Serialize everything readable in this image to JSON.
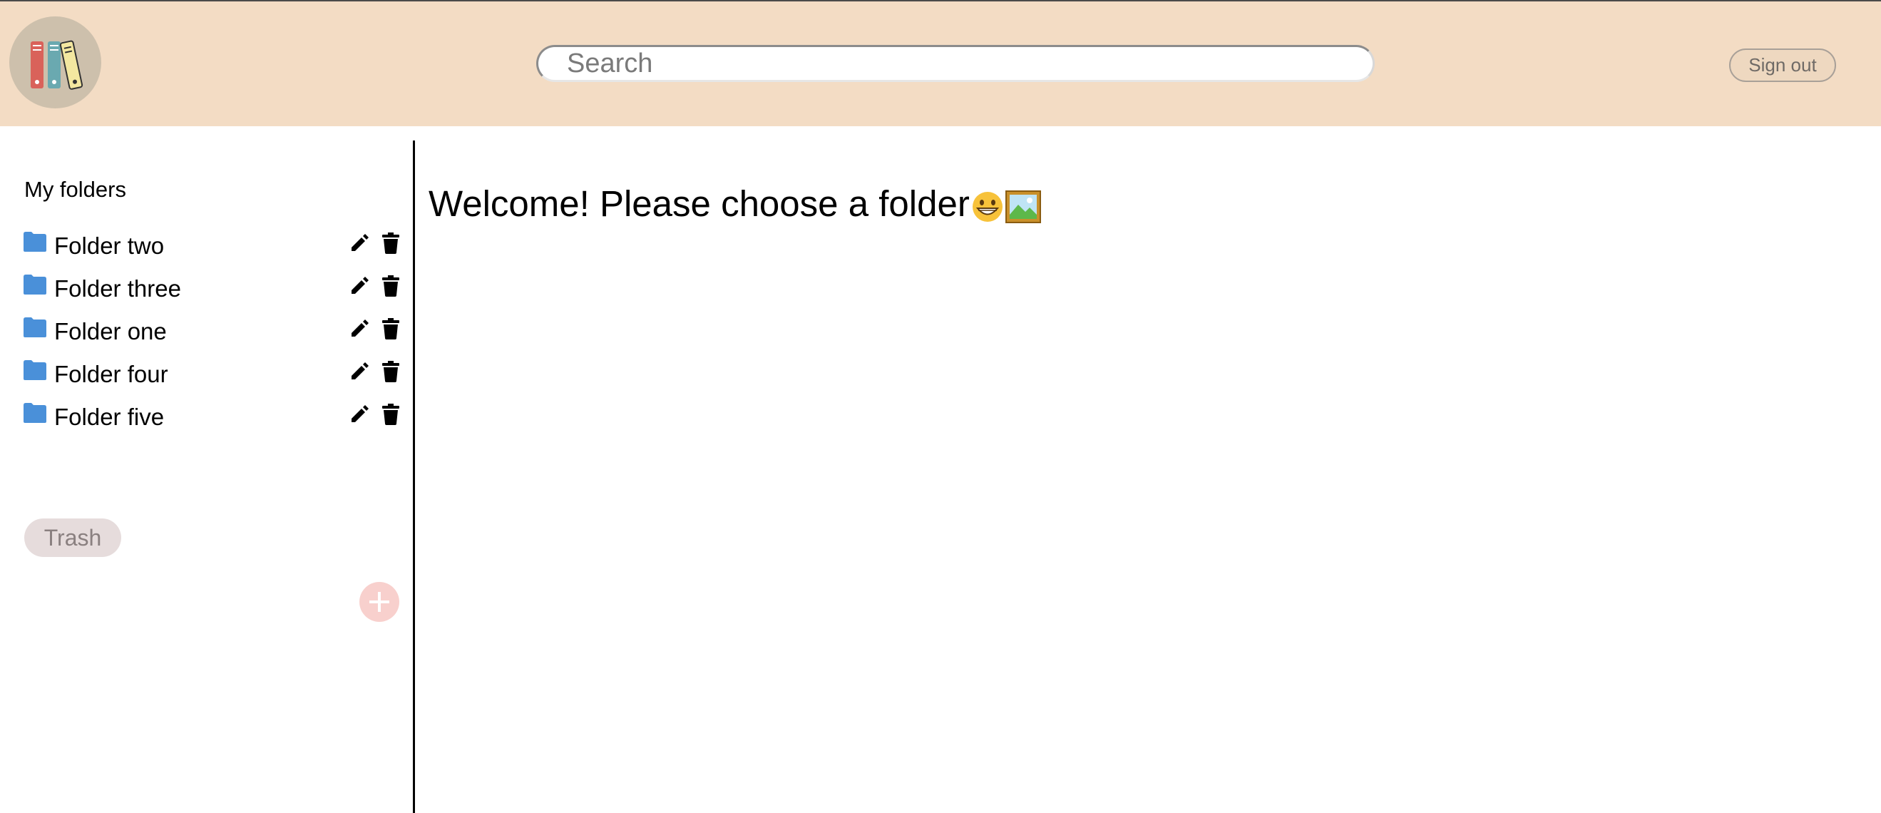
{
  "header": {
    "logo_name": "binders-logo",
    "search": {
      "placeholder": "Search",
      "value": ""
    },
    "signout_label": "Sign out"
  },
  "sidebar": {
    "title": "My folders",
    "folders": [
      {
        "label": "Folder two",
        "icon": "folder-icon"
      },
      {
        "label": "Folder three",
        "icon": "folder-icon"
      },
      {
        "label": "Folder one",
        "icon": "folder-icon"
      },
      {
        "label": "Folder four",
        "icon": "folder-icon"
      },
      {
        "label": "Folder five",
        "icon": "folder-icon"
      }
    ],
    "trash_label": "Trash",
    "add_icon": "plus-icon"
  },
  "main": {
    "welcome": "Welcome! Please choose a folder"
  },
  "colors": {
    "header_bg": "#f3dcc4",
    "folder_blue": "#4a90d9",
    "trash_bg": "#e6dcdc",
    "add_bg": "#f8d0cd"
  }
}
